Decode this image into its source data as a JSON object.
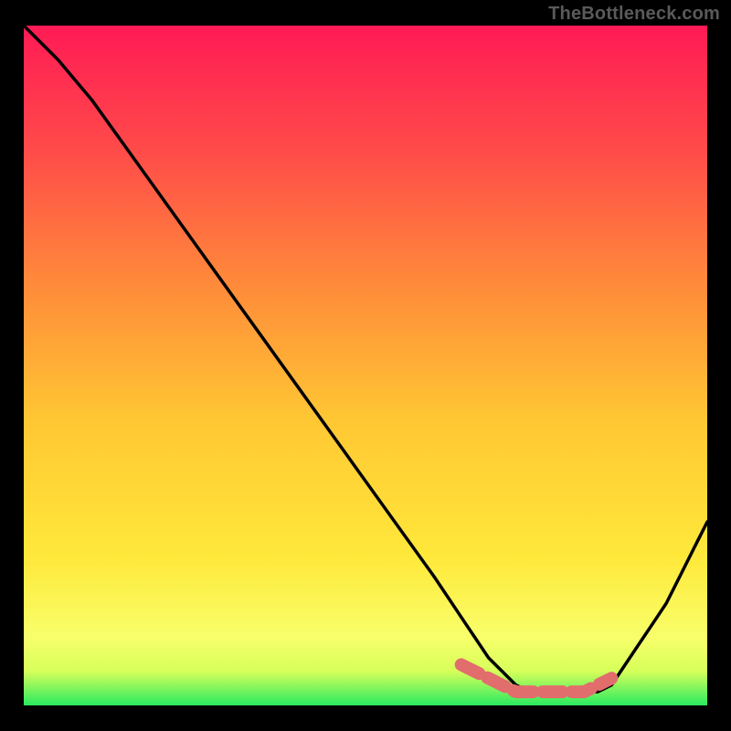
{
  "attribution": "TheBottleneck.com",
  "colors": {
    "bg_black": "#000000",
    "grad_top": "#ff1a55",
    "grad_mid_upper": "#ff6a3f",
    "grad_mid": "#ffb030",
    "grad_lower": "#ffe43a",
    "grad_bottom_yellow": "#faff70",
    "grad_green": "#2aea60",
    "curve_stroke": "#000000",
    "highlight_stroke": "#e26d6d"
  },
  "chart_data": {
    "type": "line",
    "title": "",
    "xlabel": "",
    "ylabel": "",
    "xlim": [
      0,
      100
    ],
    "ylim": [
      0,
      100
    ],
    "series": [
      {
        "name": "bottleneck-curve",
        "x": [
          0,
          5,
          10,
          15,
          20,
          25,
          30,
          35,
          40,
          45,
          50,
          55,
          60,
          62,
          64,
          66,
          68,
          70,
          72,
          74,
          76,
          78,
          80,
          82,
          84,
          86,
          88,
          90,
          92,
          94,
          96,
          98,
          100
        ],
        "y": [
          100,
          95,
          89,
          82,
          75,
          68,
          61,
          54,
          47,
          40,
          33,
          26,
          19,
          16,
          13,
          10,
          7,
          5,
          3,
          2,
          2,
          2,
          2,
          2,
          2,
          3,
          6,
          9,
          12,
          15,
          19,
          23,
          27
        ]
      }
    ],
    "highlight_segment": {
      "name": "bottom-highlight",
      "x": [
        64,
        66,
        68,
        70,
        72,
        74,
        76,
        78,
        80,
        82,
        84,
        86
      ],
      "y": [
        6,
        5,
        4,
        3,
        2,
        2,
        2,
        2,
        2,
        2,
        3,
        4
      ]
    }
  }
}
